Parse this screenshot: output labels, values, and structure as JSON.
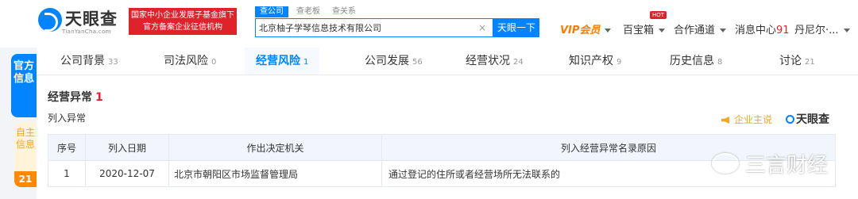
{
  "header": {
    "logo": {
      "name": "天眼查",
      "sub": "TianYanCha.com"
    },
    "banner": {
      "line1": "国家中小企业发展子基金旗下",
      "line2": "官方备案企业征信机构"
    },
    "search": {
      "tabs": [
        "查公司",
        "查老板",
        "查关系"
      ],
      "value": "北京柚子学琴信息技术有限公司",
      "button": "天眼一下"
    },
    "nav": {
      "vip": "VIP会员",
      "treasure": "百宝箱",
      "hot": "HOT",
      "channel": "合作通道",
      "messages": "消息中心",
      "message_count": "91",
      "user": "丹尼尔·..."
    }
  },
  "side": {
    "tab_a": "官方信息",
    "tab_b": "自主信息",
    "tab_b_count": "21"
  },
  "tabs": [
    {
      "label": "公司背景",
      "count": "33"
    },
    {
      "label": "司法风险",
      "count": "0"
    },
    {
      "label": "经营风险",
      "count": "1"
    },
    {
      "label": "公司发展",
      "count": "56"
    },
    {
      "label": "经营状况",
      "count": "24"
    },
    {
      "label": "知识产权",
      "count": "9"
    },
    {
      "label": "历史信息",
      "count": "8"
    },
    {
      "label": "讨论",
      "count": "21"
    }
  ],
  "section": {
    "title": "经营异常",
    "count": "1",
    "subtitle": "列入异常",
    "promo": "企业主说",
    "brand": "天眼查"
  },
  "table": {
    "headers": [
      "序号",
      "列入日期",
      "作出决定机关",
      "列入经营异常名录原因"
    ],
    "rows": [
      [
        "1",
        "2020-12-07",
        "北京市朝阳区市场监督管理局",
        "通过登记的住所或者经营场所无法联系的"
      ]
    ]
  },
  "watermark": "三言财经",
  "colors": {
    "brand": "#0084ff",
    "alert": "#e0222a",
    "vip": "#ff7a00",
    "promo": "#f5a623"
  }
}
